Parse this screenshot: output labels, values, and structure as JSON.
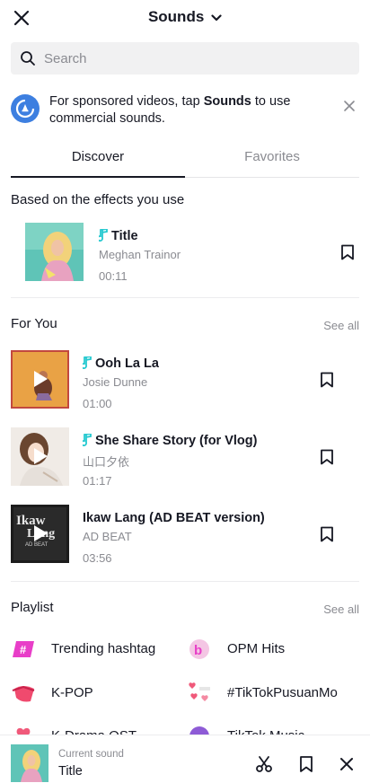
{
  "header": {
    "title": "Sounds"
  },
  "search": {
    "placeholder": "Search"
  },
  "banner": {
    "text_before": "For sponsored videos, tap ",
    "text_bold": "Sounds",
    "text_after": " to use commercial sounds."
  },
  "tabs": [
    {
      "label": "Discover",
      "active": true
    },
    {
      "label": "Favorites",
      "active": false
    }
  ],
  "effects_section": {
    "title": "Based on the effects you use",
    "tracks": [
      {
        "name": "Title",
        "artist": "Meghan Trainor",
        "duration": "00:11"
      }
    ]
  },
  "for_you": {
    "title": "For You",
    "see_all": "See all",
    "tracks": [
      {
        "name": "Ooh La La",
        "artist": "Josie Dunne",
        "duration": "01:00"
      },
      {
        "name": "She Share Story (for Vlog)",
        "artist": "山口夕依",
        "duration": "01:17"
      },
      {
        "name": "Ikaw  Lang (AD BEAT version)",
        "artist": "AD BEAT",
        "duration": "03:56"
      }
    ]
  },
  "playlist": {
    "title": "Playlist",
    "see_all": "See all",
    "items": [
      {
        "label": "Trending hashtag"
      },
      {
        "label": "OPM Hits"
      },
      {
        "label": "K-POP"
      },
      {
        "label": "#TikTokPusuanMo"
      },
      {
        "label": "K-Drama OST"
      },
      {
        "label": "TikTok Music"
      }
    ]
  },
  "current_sound": {
    "label": "Current sound",
    "title": "Title"
  },
  "colors": {
    "accent_teal": "#25c9d0",
    "text_primary": "#161823",
    "text_secondary": "#8a8b91",
    "banner_blue": "#3d7fe0",
    "search_bg": "#f1f1f2"
  }
}
